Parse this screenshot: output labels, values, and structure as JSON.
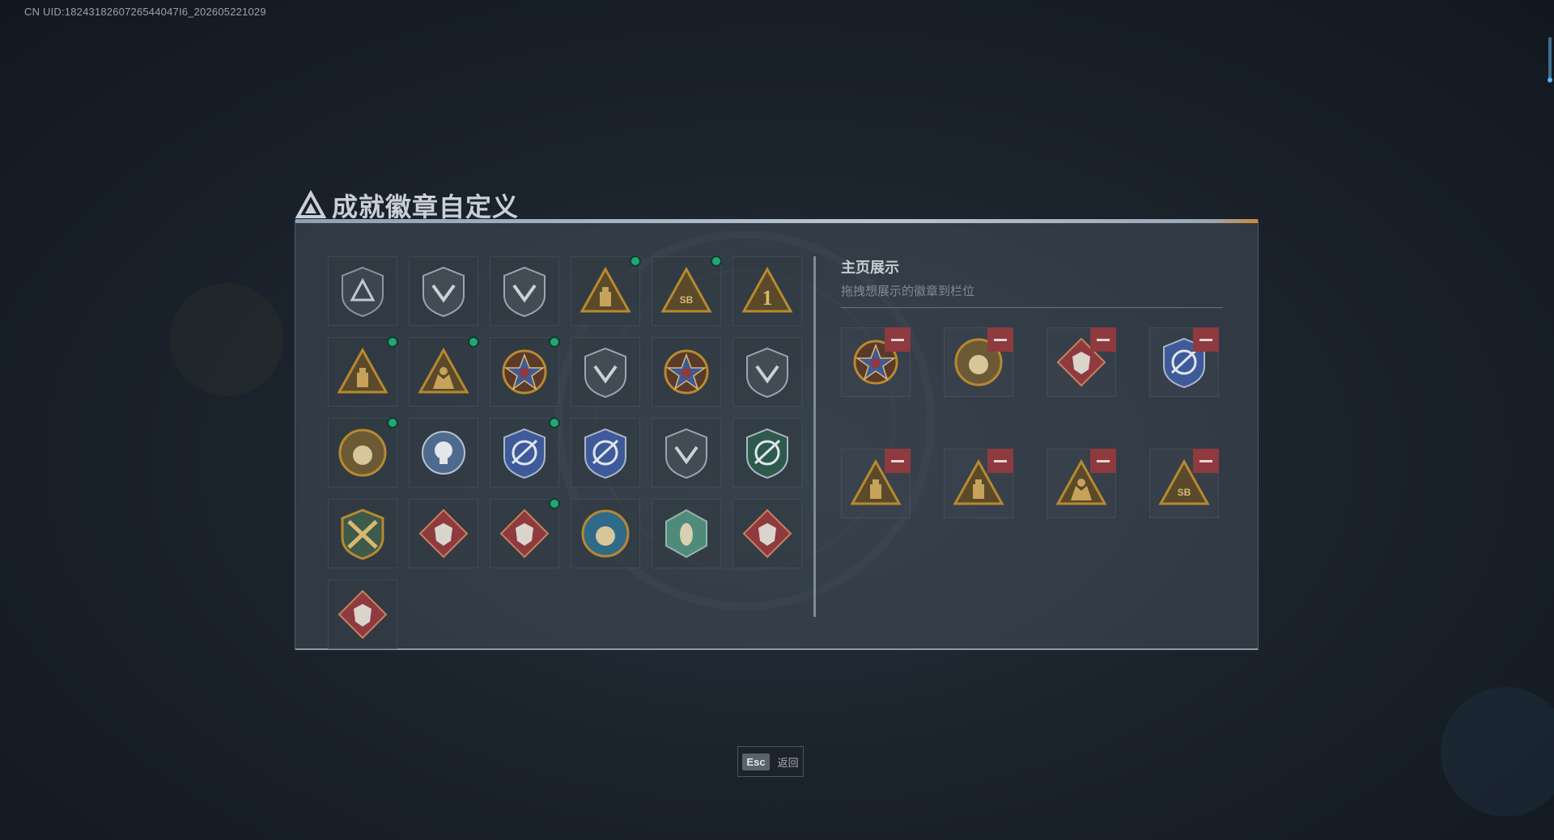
{
  "uid_text": "CN UID:1824318260726544047I6_202605221029",
  "title": "成就徽章自定义",
  "colors": {
    "gold": "#b8892f",
    "red": "#8e3a3f",
    "blue": "#3e5a9a",
    "green": "#1fa874",
    "teal": "#4f8a7a"
  },
  "badge_grid": [
    {
      "icon": "shield-triangle-badge-icon",
      "dot": false
    },
    {
      "icon": "helicopter-badge-icon",
      "dot": false
    },
    {
      "icon": "jet-shield-badge-icon",
      "dot": false
    },
    {
      "icon": "gold-triangle-badge-icon",
      "dot": true
    },
    {
      "icon": "sb-triangle-badge-icon",
      "dot": true
    },
    {
      "icon": "number-one-triangle-badge-icon",
      "dot": false
    },
    {
      "icon": "gold-triangle-badge-icon",
      "dot": true
    },
    {
      "icon": "soldier-triangle-badge-icon",
      "dot": true
    },
    {
      "icon": "star-medal-badge-icon",
      "dot": true
    },
    {
      "icon": "chevron-shield-badge-icon",
      "dot": false
    },
    {
      "icon": "star-crest-badge-icon",
      "dot": false
    },
    {
      "icon": "lion-shield-badge-icon",
      "dot": false
    },
    {
      "icon": "round-ring-badge-icon",
      "dot": true
    },
    {
      "icon": "skull-crest-badge-icon",
      "dot": false
    },
    {
      "icon": "blue-crosshair-badge-icon",
      "dot": true
    },
    {
      "icon": "blue-target-shield-badge-icon",
      "dot": false
    },
    {
      "icon": "missile-shield-badge-icon",
      "dot": false
    },
    {
      "icon": "green-target-shield-badge-icon",
      "dot": false
    },
    {
      "icon": "crossed-weapons-badge-icon",
      "dot": false
    },
    {
      "icon": "wolf-diamond-badge-icon",
      "dot": false
    },
    {
      "icon": "wolf-diamond-badge-icon",
      "dot": true
    },
    {
      "icon": "eagle-round-badge-icon",
      "dot": false
    },
    {
      "icon": "wasp-hex-badge-icon",
      "dot": false
    },
    {
      "icon": "dragon-diamond-badge-icon",
      "dot": false
    },
    {
      "icon": "runner-diamond-badge-icon",
      "dot": false
    }
  ],
  "showcase": {
    "title": "主页展示",
    "subtitle": "拖拽想展示的徽章到栏位",
    "slots": [
      {
        "icon": "star-medal-badge-icon"
      },
      {
        "icon": "round-ring-badge-icon"
      },
      {
        "icon": "wolf-diamond-badge-icon"
      },
      {
        "icon": "blue-crosshair-badge-icon"
      },
      {
        "icon": "gold-triangle-badge-icon"
      },
      {
        "icon": "gold-triangle-badge-icon"
      },
      {
        "icon": "soldier-triangle-badge-icon"
      },
      {
        "icon": "sb-triangle-badge-icon"
      }
    ]
  },
  "esc": {
    "key": "Esc",
    "label": "返回"
  }
}
